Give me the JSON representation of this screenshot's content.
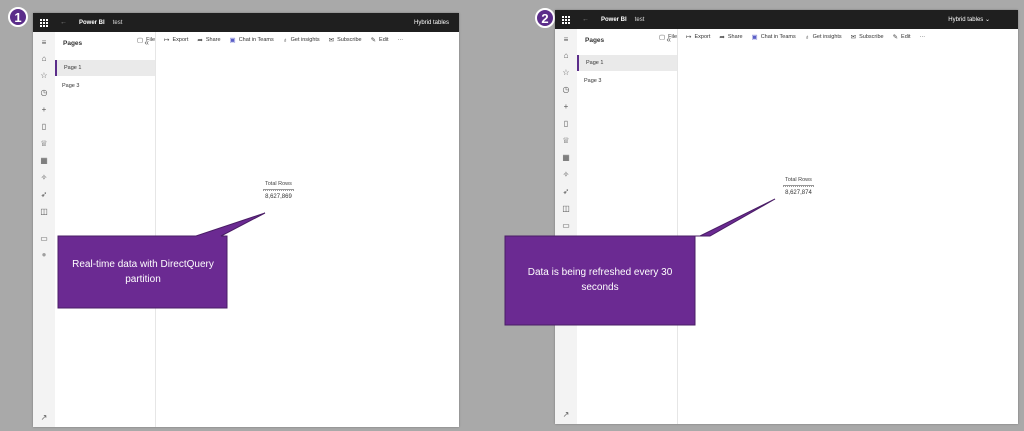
{
  "accent": "#5b2d8a",
  "callout_color": "#6b2a92",
  "panels": [
    {
      "step": "1",
      "app_name": "Power BI",
      "workspace": "test",
      "top_right": "Hybrid tables",
      "pages_title": "Pages",
      "pages": [
        "Page 1",
        "Page 3"
      ],
      "toolbar": [
        "File",
        "Export",
        "Share",
        "Chat in Teams",
        "Get insights",
        "Subscribe",
        "Edit",
        "···"
      ],
      "card_label": "Total Rows",
      "card_value": "8,627,869",
      "callout_text": "Real-time data with DirectQuery partition"
    },
    {
      "step": "2",
      "app_name": "Power BI",
      "workspace": "test",
      "top_right": "Hybrid tables",
      "pages_title": "Pages",
      "pages": [
        "Page 1",
        "Page 3"
      ],
      "toolbar": [
        "File",
        "Export",
        "Share",
        "Chat in Teams",
        "Get insights",
        "Subscribe",
        "Edit",
        "···"
      ],
      "card_label": "Total Rows",
      "card_value": "8,627,874",
      "callout_text": "Data is being refreshed every 30 seconds"
    }
  ],
  "icons": {
    "waffle": "waffle-icon",
    "rail": [
      "hamburger-icon",
      "home-icon",
      "star-icon",
      "clock-icon",
      "plus-icon",
      "apps-icon",
      "trophy-icon",
      "grid-icon",
      "scorecard-icon",
      "rocket-icon",
      "book-icon",
      "chat-icon",
      "learn-icon"
    ]
  }
}
